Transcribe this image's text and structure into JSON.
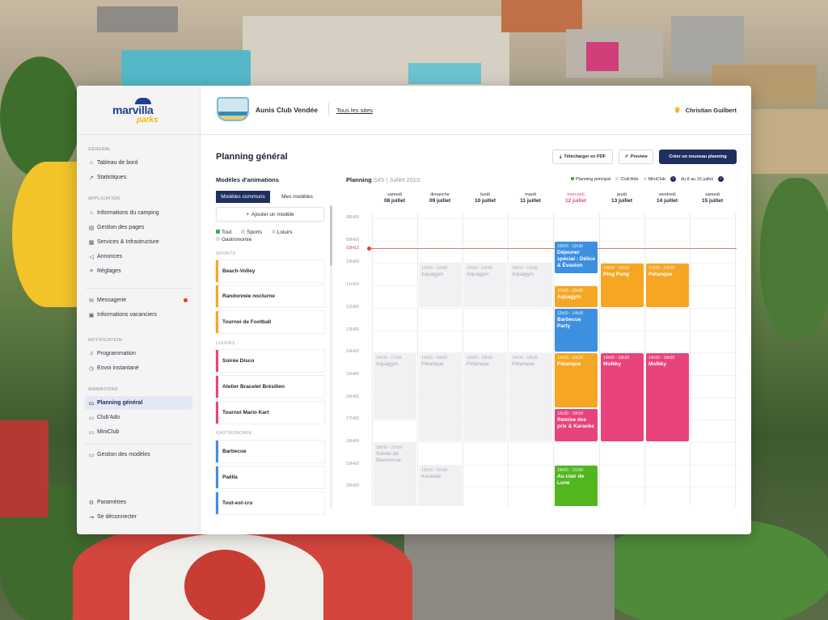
{
  "sidebar": {
    "brand": "marvilla",
    "brand_sub": "parks",
    "sections": {
      "general": "GÉNÉRAL",
      "application": "APPLICATION",
      "notification": "NOTIFICATION",
      "animations": "ANIMATIONS"
    },
    "items": {
      "dashboard": "Tableau de bord",
      "stats": "Statistiques",
      "camping_info": "Informations du camping",
      "pages": "Gestion des pages",
      "services": "Services & Infrastructure",
      "ads": "Annonces",
      "settings": "Réglages",
      "messaging": "Messagerie",
      "vacationer_info": "Informations vacanciers",
      "scheduling": "Programmation",
      "instant": "Envoi instantané",
      "general_planning": "Planning général",
      "club_ado": "Club'Ado",
      "miniclub": "MiniClub",
      "templates": "Gestion des modèles",
      "params": "Paramètres",
      "logout": "Se déconnecter"
    }
  },
  "topbar": {
    "site_name": "Aunis Club Vendée",
    "all_sites": "Tous les sites",
    "user_name": "Christian Guilbert"
  },
  "page": {
    "title": "Planning général",
    "btn_pdf": "Télécharger en PDF",
    "btn_preview": "Preview",
    "btn_create": "Créer un nouveau planning"
  },
  "models": {
    "title": "Modèles d'animations",
    "tab_common": "Modèles communs",
    "tab_mine": "Mes modèles",
    "add": "Ajouter un modèle",
    "filters": [
      "Tout",
      "Sports",
      "Loisirs",
      "Gastronomie"
    ],
    "cat_sports": "SPORTS",
    "cat_leisure": "LOISIRS",
    "cat_food": "GASTRONOMIE",
    "sports": [
      "Beach-Volley",
      "Randonnée nocturne",
      "Tournoi de Football"
    ],
    "leisure": [
      "Soirée Disco",
      "Atelier Bracelet Brésilien",
      "Tournoi Mario Kart"
    ],
    "food": [
      "Barbecue",
      "Paëlla",
      "Tout-est-cru"
    ]
  },
  "planning": {
    "title": "Planning",
    "week": "S45",
    "month": "Juillet 2023",
    "legend_main": "Planning principal",
    "legend_club": "Club'Ado",
    "legend_mini": "MiniClub",
    "range": "du 8 au 15 juillet",
    "now": "10H12",
    "hours": [
      "08H00",
      "09H00",
      "10H00",
      "11H00",
      "12H00",
      "13H00",
      "14H00",
      "15H00",
      "16H00",
      "17H00",
      "18H00",
      "19H00",
      "20H00",
      "21H00"
    ],
    "days": [
      {
        "name": "samedi",
        "date": "08 juillet"
      },
      {
        "name": "dimanche",
        "date": "09 juillet"
      },
      {
        "name": "lundi",
        "date": "10 juillet"
      },
      {
        "name": "mardi",
        "date": "11 juillet"
      },
      {
        "name": "mercredi",
        "date": "12 juillet"
      },
      {
        "name": "jeudi",
        "date": "13 juillet"
      },
      {
        "name": "vendredi",
        "date": "14 juillet"
      },
      {
        "name": "samedi",
        "date": "15 juillet"
      }
    ],
    "events": [
      {
        "time": "10h00 - 12h00",
        "title": "Aquagym"
      },
      {
        "time": "10h00 - 12h00",
        "title": "Aquagym"
      },
      {
        "time": "10h00 - 12h00",
        "title": "Aquagym"
      },
      {
        "time": "14h00 - 17h00",
        "title": "Aquagym"
      },
      {
        "time": "14h00 - 18h00",
        "title": "Pétanque"
      },
      {
        "time": "14h00 - 18h00",
        "title": "Pétanque"
      },
      {
        "time": "14h00 - 18h00",
        "title": "Pétanque"
      },
      {
        "time": "18h00 - 21h00",
        "title": "Soirée de Bienvenue"
      },
      {
        "time": "19h00 - 21h00",
        "title": "Karaoké"
      },
      {
        "time": "10h00 - 11h30",
        "title": "Déjeuner spécial : Délice & Évasion"
      },
      {
        "time": "11h00 - 12h00",
        "title": "Aquagym"
      },
      {
        "time": "12h00 - 14h00",
        "title": "Barbecue Party"
      },
      {
        "time": "14h00 - 16h30",
        "title": "Pétanque"
      },
      {
        "time": "16h30 - 18h00",
        "title": "Remise des prix & Karaoke"
      },
      {
        "time": "19h00 - 21h00",
        "title": "Au clair de Lune"
      },
      {
        "time": "10h00 - 12h00",
        "title": "Ping Pong"
      },
      {
        "time": "14h00 - 18h00",
        "title": "Molkky"
      },
      {
        "time": "10h00 - 12h00",
        "title": "Pétanque"
      },
      {
        "time": "14h00 - 18h00",
        "title": "Molkky"
      }
    ]
  },
  "help": "?"
}
